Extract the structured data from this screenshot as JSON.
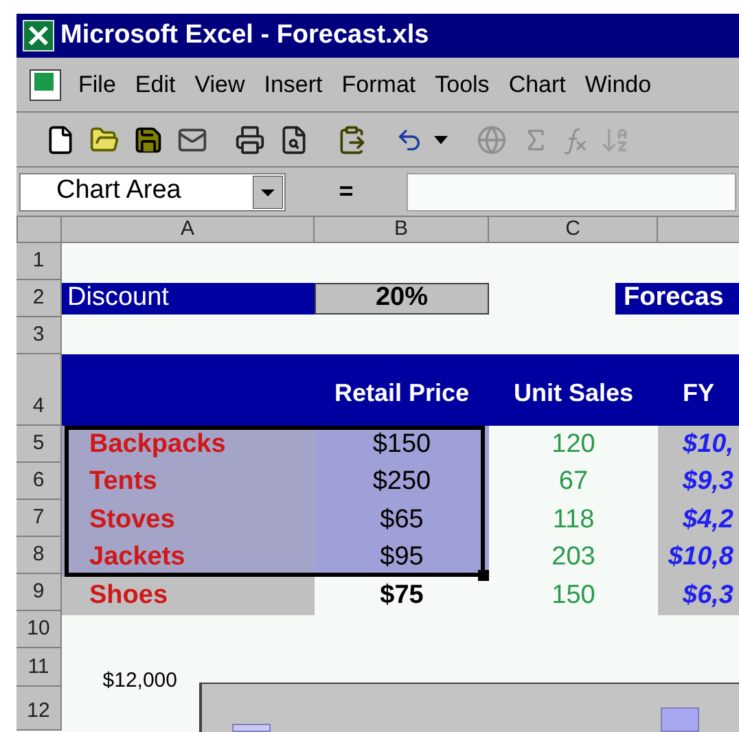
{
  "window": {
    "title": "Microsoft Excel - Forecast.xls"
  },
  "menu": [
    {
      "label": "File"
    },
    {
      "label": "Edit"
    },
    {
      "label": "View"
    },
    {
      "label": "Insert"
    },
    {
      "label": "Format"
    },
    {
      "label": "Tools"
    },
    {
      "label": "Chart"
    },
    {
      "label": "Windo"
    }
  ],
  "name_box": {
    "value": "Chart Area"
  },
  "formula_bar": {
    "equals": "="
  },
  "columns": [
    "A",
    "B",
    "C"
  ],
  "row_numbers": [
    "1",
    "2",
    "3",
    "4",
    "5",
    "6",
    "7",
    "8",
    "9",
    "10",
    "11",
    "12"
  ],
  "discount": {
    "label": "Discount",
    "value": "20%"
  },
  "forecast_label": "Forecas",
  "headers": [
    "Retail Price",
    "Unit Sales",
    "FY"
  ],
  "products": [
    {
      "name": "Backpacks",
      "price": "$150",
      "units": "120",
      "forecast": "$10,",
      "selected": true,
      "price_bold": false
    },
    {
      "name": "Tents",
      "price": "$250",
      "units": "67",
      "forecast": "$9,3",
      "selected": true,
      "price_bold": false
    },
    {
      "name": "Stoves",
      "price": "$65",
      "units": "118",
      "forecast": "$4,2",
      "selected": true,
      "price_bold": false
    },
    {
      "name": "Jackets",
      "price": "$95",
      "units": "203",
      "forecast": "$10,8",
      "selected": true,
      "price_bold": false
    },
    {
      "name": "Shoes",
      "price": "$75",
      "units": "150",
      "forecast": "$6,3",
      "selected": false,
      "price_bold": true
    }
  ],
  "chart": {
    "y_label": "$12,000"
  }
}
